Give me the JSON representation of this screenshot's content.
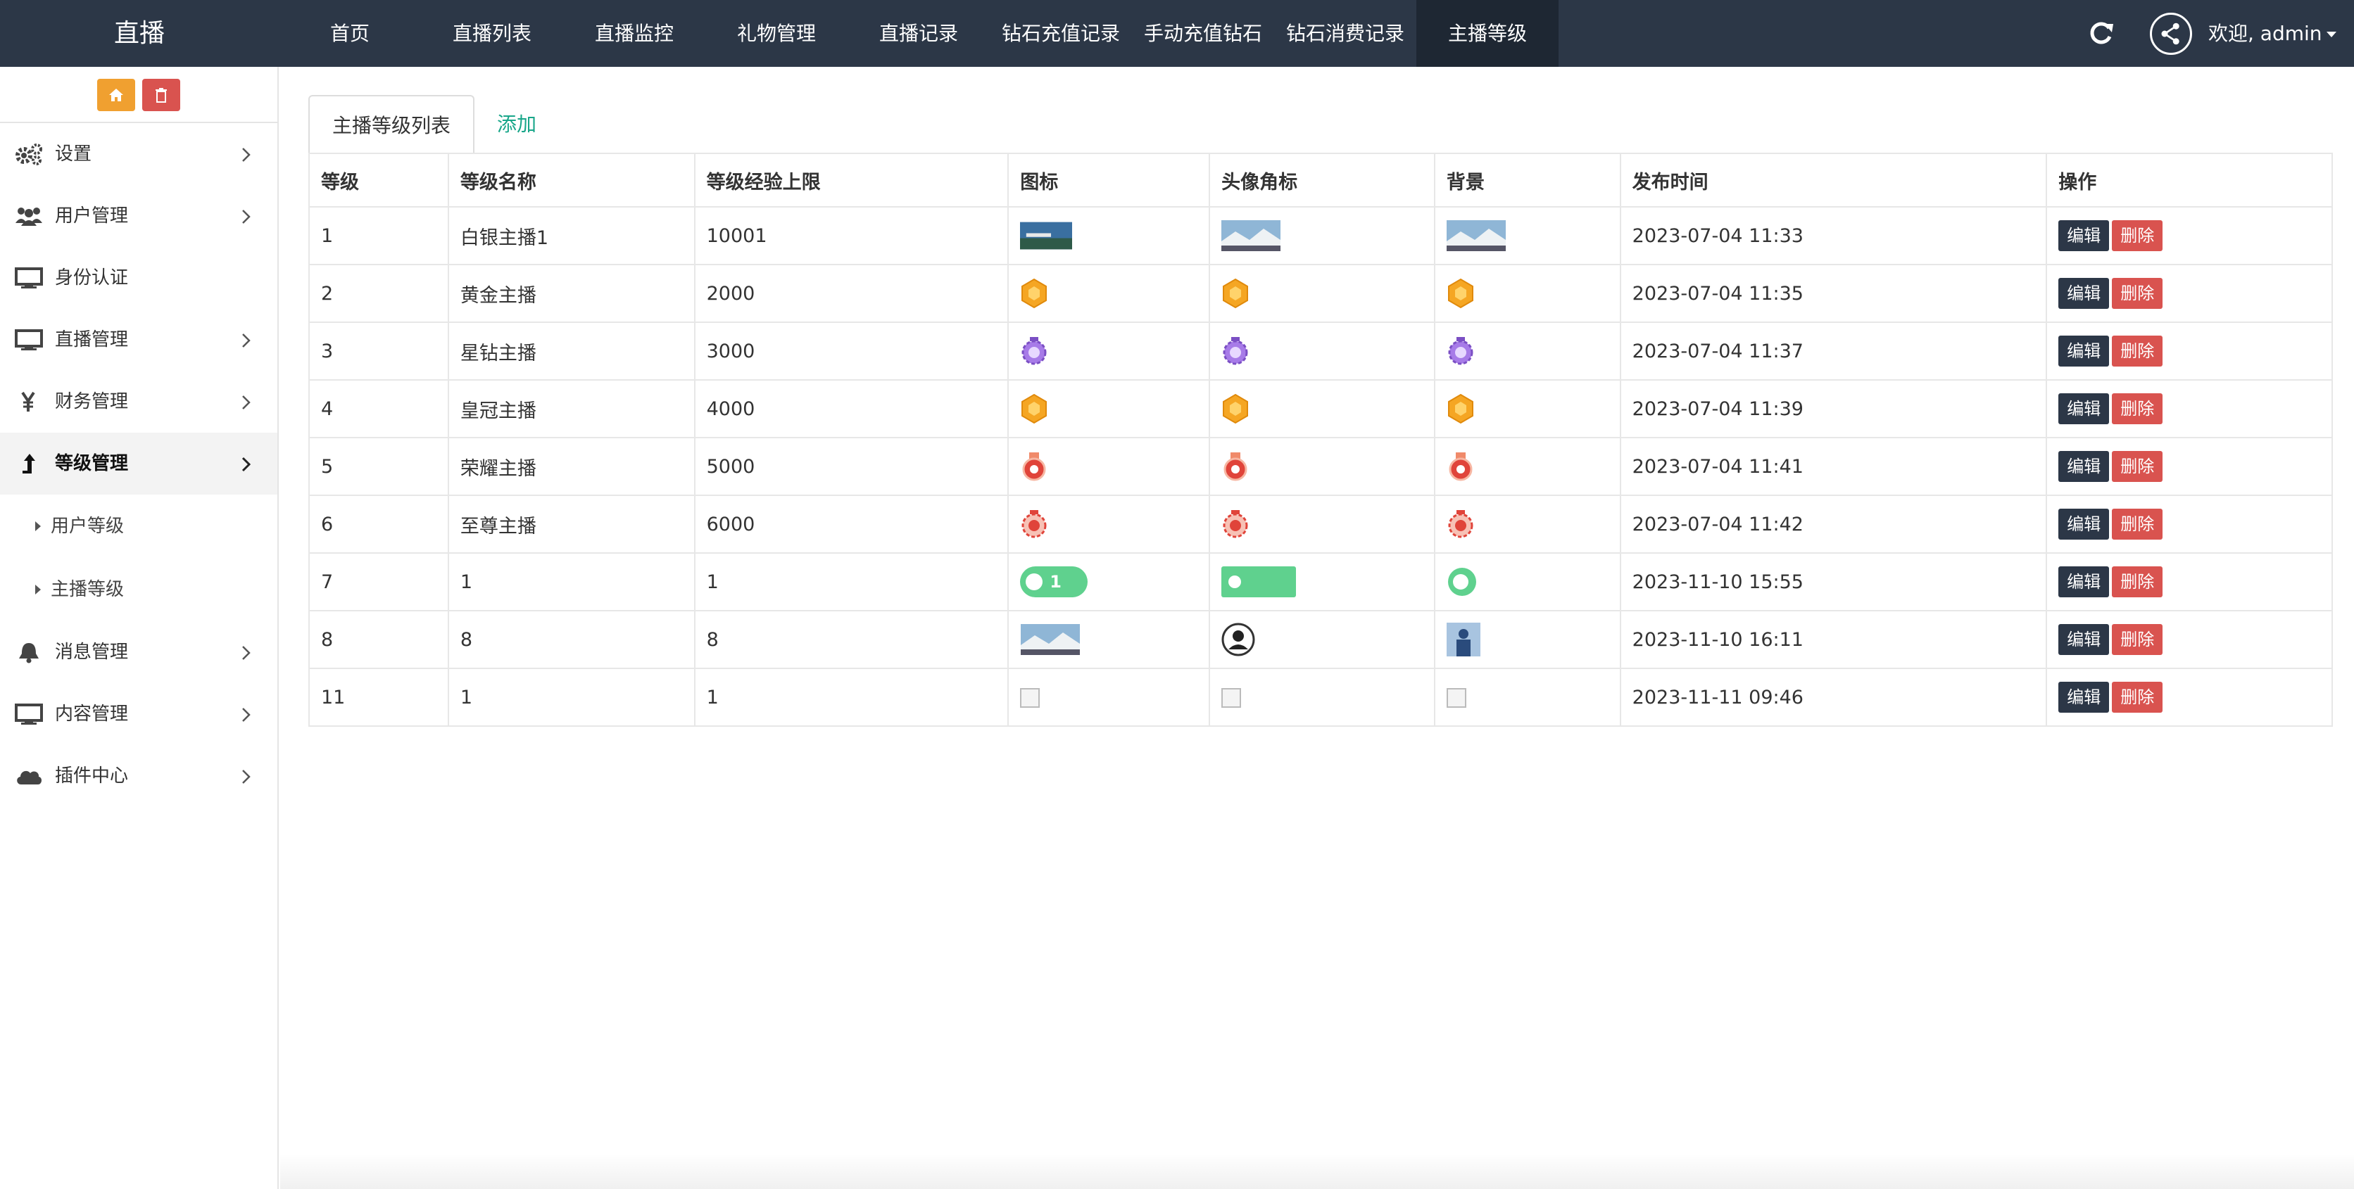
{
  "brand": "直播",
  "topnav": [
    "首页",
    "直播列表",
    "直播监控",
    "礼物管理",
    "直播记录",
    "钻石充值记录",
    "手动充值钻石",
    "钻石消费记录",
    "主播等级"
  ],
  "topnav_active_index": 8,
  "user": {
    "welcome": "欢迎, admin"
  },
  "sidebar": {
    "items": [
      {
        "label": "设置",
        "icon": "gears-icon"
      },
      {
        "label": "用户管理",
        "icon": "users-icon"
      },
      {
        "label": "身份认证",
        "icon": "monitor-icon"
      },
      {
        "label": "直播管理",
        "icon": "monitor-icon"
      },
      {
        "label": "财务管理",
        "icon": "yen-icon"
      },
      {
        "label": "等级管理",
        "icon": "level-up-icon"
      },
      {
        "label": "消息管理",
        "icon": "bell-icon"
      },
      {
        "label": "内容管理",
        "icon": "monitor-icon"
      },
      {
        "label": "插件中心",
        "icon": "cloud-icon"
      }
    ],
    "sub_items": [
      "用户等级",
      "主播等级"
    ]
  },
  "tabs": {
    "list": "主播等级列表",
    "add": "添加"
  },
  "table": {
    "headers": [
      "等级",
      "等级名称",
      "等级经验上限",
      "图标",
      "头像角标",
      "背景",
      "发布时间",
      "操作"
    ],
    "rows": [
      {
        "level": "1",
        "name": "白银主播1",
        "exp": "10001",
        "icon": "photo",
        "time": "2023-07-04 11:33"
      },
      {
        "level": "2",
        "name": "黄金主播",
        "exp": "2000",
        "icon": "gold-hex",
        "time": "2023-07-04 11:35"
      },
      {
        "level": "3",
        "name": "星钻主播",
        "exp": "3000",
        "icon": "purple-gear",
        "time": "2023-07-04 11:37"
      },
      {
        "level": "4",
        "name": "皇冠主播",
        "exp": "4000",
        "icon": "gold-hex",
        "time": "2023-07-04 11:39"
      },
      {
        "level": "5",
        "name": "荣耀主播",
        "exp": "5000",
        "icon": "red-medal",
        "time": "2023-07-04 11:41"
      },
      {
        "level": "6",
        "name": "至尊主播",
        "exp": "6000",
        "icon": "red-gear",
        "time": "2023-07-04 11:42"
      },
      {
        "level": "7",
        "name": "1",
        "exp": "1",
        "icon": "green-pill",
        "pill_text": "1",
        "time": "2023-11-10 15:55"
      },
      {
        "level": "8",
        "name": "8",
        "exp": "8",
        "icon": "mixed",
        "time": "2023-11-10 16:11"
      },
      {
        "level": "11",
        "name": "1",
        "exp": "1",
        "icon": "broken",
        "time": "2023-11-11 09:46"
      }
    ],
    "actions": {
      "edit": "编辑",
      "delete": "删除"
    }
  },
  "colors": {
    "topbar": "#2c3747",
    "active_nav": "#1e2733",
    "edit_btn": "#2c3747",
    "delete_btn": "#d9534f",
    "home_btn": "#f0a030",
    "link": "#18a689"
  }
}
